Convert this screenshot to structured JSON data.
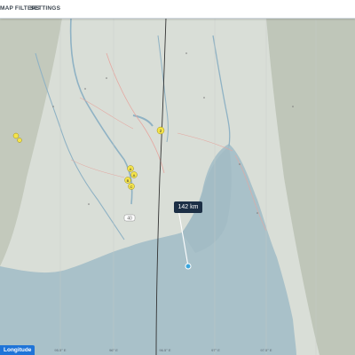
{
  "toolbar": {
    "map_filters_label": "MAP FILTERS",
    "settings_label": "SETTINGS"
  },
  "distance": {
    "label": "142 km"
  },
  "coords": {
    "button_label": "Longitude"
  },
  "axis": {
    "longitude_ticks": [
      "95.5° E",
      "96° E",
      "96.5° E",
      "97° E",
      "97.5° E"
    ]
  },
  "markers": {
    "highway_shield": "40",
    "poi_labels": [
      "2",
      "A",
      "A",
      "B",
      "C"
    ]
  },
  "colors": {
    "sea": "#a9c1c9",
    "land": "#d9ded7",
    "terrain_dark": "#b4bcae",
    "river": "#8fb2c4",
    "marker_yellow": "#f4e34a",
    "distance_line": "#ffffff",
    "route_line": "#333333",
    "accent": "#1f74d8"
  }
}
